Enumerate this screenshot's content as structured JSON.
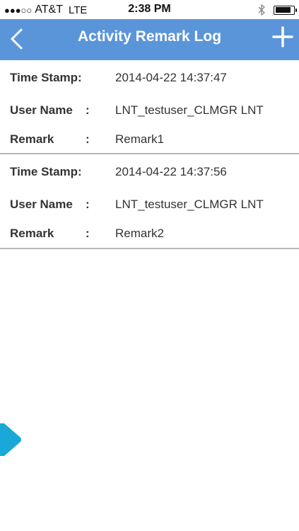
{
  "status_bar": {
    "signal": "●●●○○",
    "carrier": "AT&T",
    "network": "LTE",
    "time": "2:38 PM",
    "battery_level": 0.9
  },
  "nav": {
    "title": "Activity Remark Log",
    "back_icon": "chevron-left-icon",
    "add_icon": "plus-icon",
    "background_color": "#5b95d9"
  },
  "entries": [
    {
      "timestamp_label": "Time Stamp:",
      "timestamp_value": "2014-04-22 14:37:47",
      "username_label": "User Name",
      "username_colon": ":",
      "username_value": "LNT_testuser_CLMGR LNT",
      "remark_label": "Remark",
      "remark_colon": ":",
      "remark_value": "Remark1"
    },
    {
      "timestamp_label": "Time Stamp:",
      "timestamp_value": "2014-04-22 14:37:56",
      "username_label": "User Name",
      "username_colon": ":",
      "username_value": "LNT_testuser_CLMGR LNT",
      "remark_label": "Remark",
      "remark_colon": ":",
      "remark_value": "Remark2"
    }
  ],
  "side_handle": {
    "icon": "triangle-right-icon",
    "color": "#19a8d8"
  }
}
